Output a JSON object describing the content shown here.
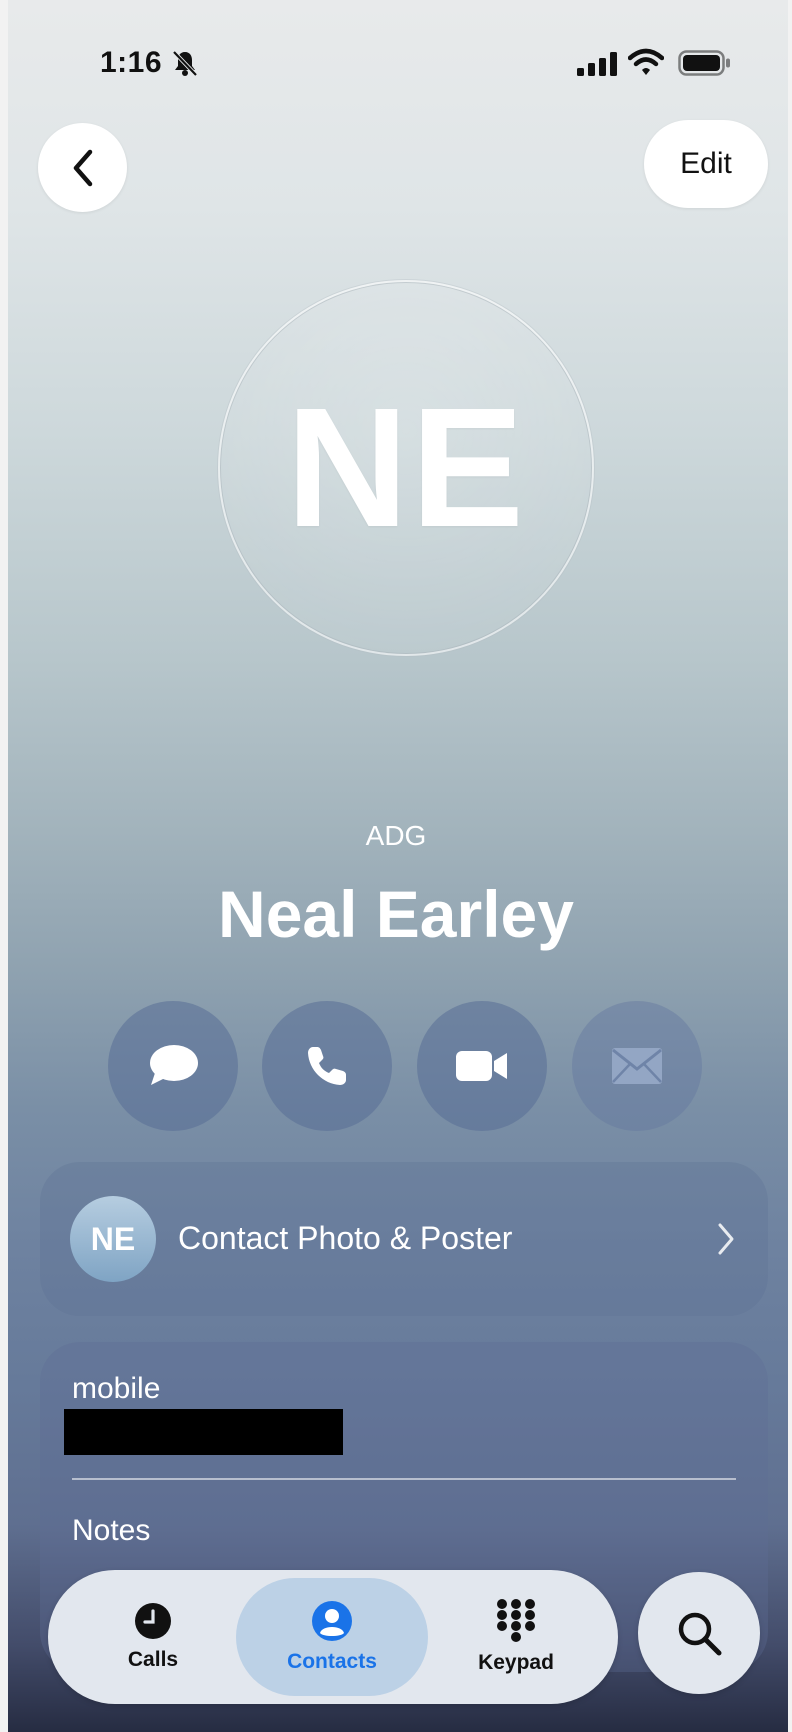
{
  "status_bar": {
    "time": "1:16",
    "icons": [
      "bell-slash-icon",
      "signal-icon",
      "wifi-icon",
      "battery-icon"
    ]
  },
  "header": {
    "back_icon": "chevron-left-icon",
    "edit_label": "Edit"
  },
  "contact": {
    "initials": "NE",
    "company": "ADG",
    "name": "Neal Earley"
  },
  "actions": [
    {
      "icon": "message-icon",
      "enabled": true
    },
    {
      "icon": "phone-icon",
      "enabled": true
    },
    {
      "icon": "video-icon",
      "enabled": true
    },
    {
      "icon": "mail-icon",
      "enabled": false
    }
  ],
  "photo_card": {
    "initials": "NE",
    "label": "Contact Photo & Poster"
  },
  "info_card": {
    "mobile_label": "mobile",
    "mobile_value": "",
    "notes_label": "Notes"
  },
  "tab_bar": {
    "tabs": [
      {
        "label": "Calls",
        "icon": "clock-icon",
        "selected": false
      },
      {
        "label": "Contacts",
        "icon": "person-icon",
        "selected": true
      },
      {
        "label": "Keypad",
        "icon": "keypad-icon",
        "selected": false
      }
    ],
    "search_icon": "search-icon"
  },
  "colors": {
    "accent": "#1a73e8",
    "white": "#ffffff"
  }
}
